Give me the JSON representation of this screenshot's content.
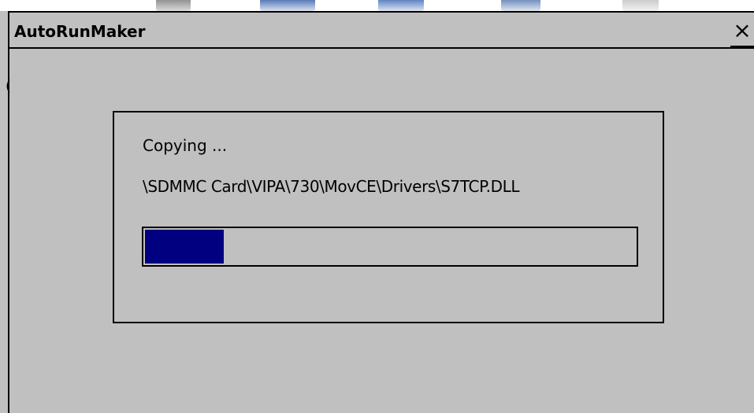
{
  "window": {
    "title": "AutoRunMaker",
    "close_glyph": "×",
    "edge_fragment": "("
  },
  "dialog": {
    "status": "Copying ...",
    "file_path": "\\SDMMC Card\\VIPA\\730\\MovCE\\Drivers\\S7TCP.DLL",
    "progress_fraction": 0.16
  },
  "colors": {
    "background": "#c0c0c0",
    "border": "#000000",
    "progress_fill": "#000080",
    "text": "#000000"
  },
  "icons": {
    "close": "close-icon"
  }
}
